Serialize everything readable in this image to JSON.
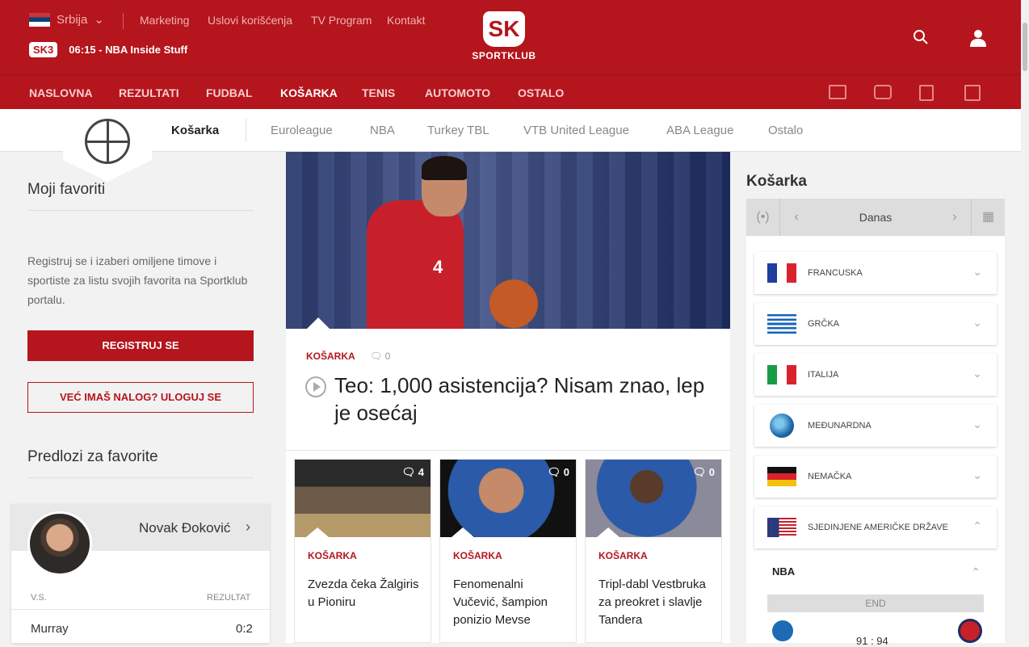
{
  "header": {
    "country": "Srbija",
    "top_links": [
      "Marketing",
      "Uslovi korišćenja",
      "TV Program",
      "Kontakt"
    ],
    "live_channel": "SK3",
    "live_show": "06:15 - NBA Inside Stuff",
    "logo_mark": "SK",
    "logo_text": "SPORTKLUB"
  },
  "nav": {
    "items": [
      "NASLOVNA",
      "REZULTATI",
      "FUDBAL",
      "KOŠARKA",
      "TENIS",
      "AUTOMOTO",
      "OSTALO"
    ],
    "active": "KOŠARKA"
  },
  "subnav": {
    "items": [
      "Košarka",
      "Euroleague",
      "NBA",
      "Turkey TBL",
      "VTB United League",
      "ABA League",
      "Ostalo"
    ]
  },
  "left": {
    "favorites_title": "Moji favoriti",
    "favorites_desc": "Registruj se i izaberi omiljene timove i sportiste za listu svojih favorita na Sportklub portalu.",
    "register_btn": "REGISTRUJ SE",
    "login_btn": "VEĆ IMAŠ NALOG? ULOGUJ SE",
    "suggestions_title": "Predlozi za favorite",
    "player": {
      "name": "Novak Đoković",
      "vs_label": "V.S.",
      "result_label": "REZULTAT",
      "opponent": "Murray",
      "score": "0:2"
    }
  },
  "main": {
    "hero": {
      "category": "KOŠARKA",
      "comments": "0",
      "jersey_number": "4",
      "title": "Teo: 1,000 asistencija? Nisam znao, lep je osećaj"
    },
    "cards": [
      {
        "category": "KOŠARKA",
        "comments": "4",
        "title": "Zvezda čeka Žalgiris u Pioniru"
      },
      {
        "category": "KOŠARKA",
        "comments": "0",
        "title": "Fenomenalni Vučević, šampion ponizio Mevse"
      },
      {
        "category": "KOŠARKA",
        "comments": "0",
        "title": "Tripl-dabl Vestbruka za preokret i slavlje Tandera"
      }
    ]
  },
  "right": {
    "title": "Košarka",
    "date_label": "Danas",
    "countries": [
      "FRANCUSKA",
      "GRČKA",
      "ITALIJA",
      "MEĐUNARDNA",
      "NEMAČKA",
      "SJEDINJENE AMERIČKE DRŽAVE"
    ],
    "league": "NBA",
    "game_status": "END",
    "game_score": "91 : 94"
  }
}
